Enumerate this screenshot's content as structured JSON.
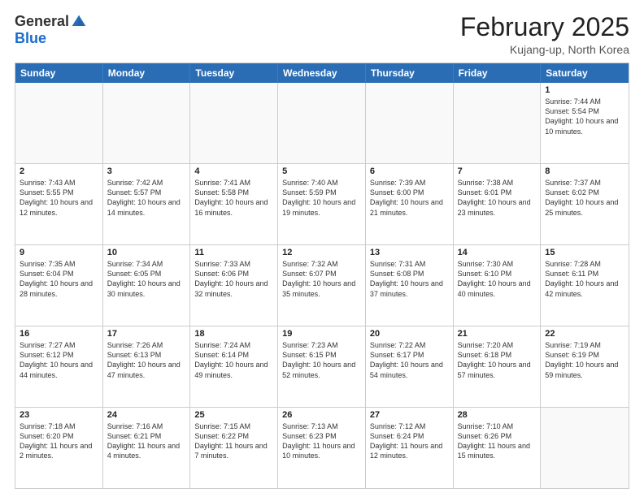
{
  "logo": {
    "general": "General",
    "blue": "Blue"
  },
  "title": "February 2025",
  "location": "Kujang-up, North Korea",
  "weekdays": [
    "Sunday",
    "Monday",
    "Tuesday",
    "Wednesday",
    "Thursday",
    "Friday",
    "Saturday"
  ],
  "rows": [
    [
      {
        "day": "",
        "empty": true
      },
      {
        "day": "",
        "empty": true
      },
      {
        "day": "",
        "empty": true
      },
      {
        "day": "",
        "empty": true
      },
      {
        "day": "",
        "empty": true
      },
      {
        "day": "",
        "empty": true
      },
      {
        "day": "1",
        "sunrise": "7:44 AM",
        "sunset": "5:54 PM",
        "daylight": "10 hours and 10 minutes."
      }
    ],
    [
      {
        "day": "2",
        "sunrise": "7:43 AM",
        "sunset": "5:55 PM",
        "daylight": "10 hours and 12 minutes."
      },
      {
        "day": "3",
        "sunrise": "7:42 AM",
        "sunset": "5:57 PM",
        "daylight": "10 hours and 14 minutes."
      },
      {
        "day": "4",
        "sunrise": "7:41 AM",
        "sunset": "5:58 PM",
        "daylight": "10 hours and 16 minutes."
      },
      {
        "day": "5",
        "sunrise": "7:40 AM",
        "sunset": "5:59 PM",
        "daylight": "10 hours and 19 minutes."
      },
      {
        "day": "6",
        "sunrise": "7:39 AM",
        "sunset": "6:00 PM",
        "daylight": "10 hours and 21 minutes."
      },
      {
        "day": "7",
        "sunrise": "7:38 AM",
        "sunset": "6:01 PM",
        "daylight": "10 hours and 23 minutes."
      },
      {
        "day": "8",
        "sunrise": "7:37 AM",
        "sunset": "6:02 PM",
        "daylight": "10 hours and 25 minutes."
      }
    ],
    [
      {
        "day": "9",
        "sunrise": "7:35 AM",
        "sunset": "6:04 PM",
        "daylight": "10 hours and 28 minutes."
      },
      {
        "day": "10",
        "sunrise": "7:34 AM",
        "sunset": "6:05 PM",
        "daylight": "10 hours and 30 minutes."
      },
      {
        "day": "11",
        "sunrise": "7:33 AM",
        "sunset": "6:06 PM",
        "daylight": "10 hours and 32 minutes."
      },
      {
        "day": "12",
        "sunrise": "7:32 AM",
        "sunset": "6:07 PM",
        "daylight": "10 hours and 35 minutes."
      },
      {
        "day": "13",
        "sunrise": "7:31 AM",
        "sunset": "6:08 PM",
        "daylight": "10 hours and 37 minutes."
      },
      {
        "day": "14",
        "sunrise": "7:30 AM",
        "sunset": "6:10 PM",
        "daylight": "10 hours and 40 minutes."
      },
      {
        "day": "15",
        "sunrise": "7:28 AM",
        "sunset": "6:11 PM",
        "daylight": "10 hours and 42 minutes."
      }
    ],
    [
      {
        "day": "16",
        "sunrise": "7:27 AM",
        "sunset": "6:12 PM",
        "daylight": "10 hours and 44 minutes."
      },
      {
        "day": "17",
        "sunrise": "7:26 AM",
        "sunset": "6:13 PM",
        "daylight": "10 hours and 47 minutes."
      },
      {
        "day": "18",
        "sunrise": "7:24 AM",
        "sunset": "6:14 PM",
        "daylight": "10 hours and 49 minutes."
      },
      {
        "day": "19",
        "sunrise": "7:23 AM",
        "sunset": "6:15 PM",
        "daylight": "10 hours and 52 minutes."
      },
      {
        "day": "20",
        "sunrise": "7:22 AM",
        "sunset": "6:17 PM",
        "daylight": "10 hours and 54 minutes."
      },
      {
        "day": "21",
        "sunrise": "7:20 AM",
        "sunset": "6:18 PM",
        "daylight": "10 hours and 57 minutes."
      },
      {
        "day": "22",
        "sunrise": "7:19 AM",
        "sunset": "6:19 PM",
        "daylight": "10 hours and 59 minutes."
      }
    ],
    [
      {
        "day": "23",
        "sunrise": "7:18 AM",
        "sunset": "6:20 PM",
        "daylight": "11 hours and 2 minutes."
      },
      {
        "day": "24",
        "sunrise": "7:16 AM",
        "sunset": "6:21 PM",
        "daylight": "11 hours and 4 minutes."
      },
      {
        "day": "25",
        "sunrise": "7:15 AM",
        "sunset": "6:22 PM",
        "daylight": "11 hours and 7 minutes."
      },
      {
        "day": "26",
        "sunrise": "7:13 AM",
        "sunset": "6:23 PM",
        "daylight": "11 hours and 10 minutes."
      },
      {
        "day": "27",
        "sunrise": "7:12 AM",
        "sunset": "6:24 PM",
        "daylight": "11 hours and 12 minutes."
      },
      {
        "day": "28",
        "sunrise": "7:10 AM",
        "sunset": "6:26 PM",
        "daylight": "11 hours and 15 minutes."
      },
      {
        "day": "",
        "empty": true
      }
    ]
  ],
  "labels": {
    "sunrise": "Sunrise:",
    "sunset": "Sunset:",
    "daylight": "Daylight:"
  }
}
